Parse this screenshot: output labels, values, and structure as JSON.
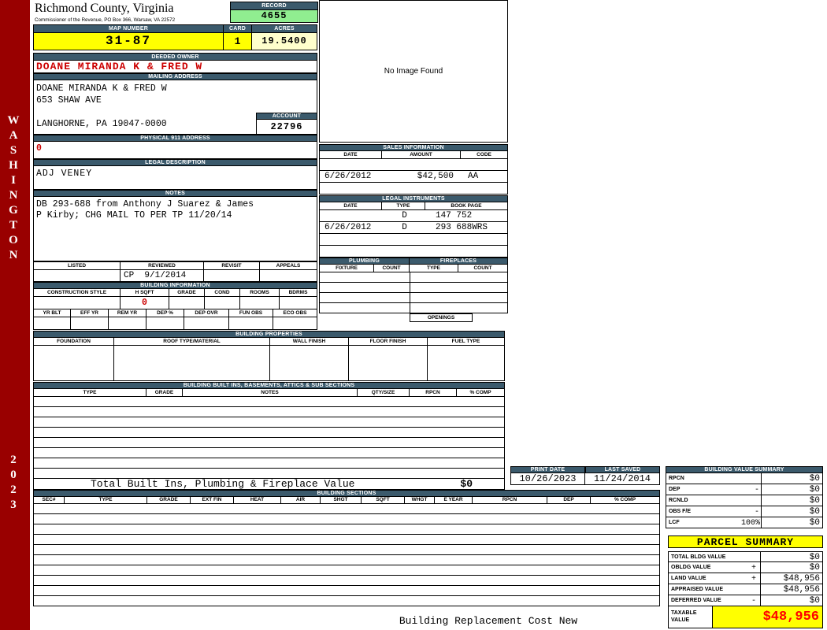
{
  "sidebar": {
    "vertical_text": "WASHINGTON",
    "year": "2023"
  },
  "county": {
    "title": "Richmond County, Virginia",
    "subtitle": "Commissioner of the Revenue, PO Box 366, Warsaw, VA 22572"
  },
  "record": {
    "label": "RECORD",
    "value": "4655"
  },
  "map": {
    "map_number_label": "MAP NUMBER",
    "map_number": "31-87",
    "card_label": "CARD",
    "card": "1",
    "acres_label": "ACRES",
    "acres": "19.5400"
  },
  "owner": {
    "deeded_owner_label": "DEEDED OWNER",
    "deeded_owner": "DOANE MIRANDA K & FRED W",
    "mailing_address_label": "MAILING ADDRESS",
    "mailing_line1": "DOANE MIRANDA K & FRED W",
    "mailing_line2": "653 SHAW AVE",
    "mailing_line3": "",
    "mailing_line4": "LANGHORNE, PA 19047-0000",
    "account_label": "ACCOUNT",
    "account": "22796",
    "physical_address_label": "PHYSICAL 911 ADDRESS",
    "physical_address": "0",
    "legal_description_label": "LEGAL DESCRIPTION",
    "legal_description": "ADJ VENEY",
    "notes_label": "NOTES",
    "notes_line1": "DB 293-688 from Anthony J Suarez & James",
    "notes_line2": "P Kirby; CHG MAIL TO PER TP 11/20/14"
  },
  "review": {
    "listed_label": "LISTED",
    "reviewed_label": "REVIEWED",
    "revisit_label": "REVISIT",
    "appeals_label": "APPEALS",
    "reviewed_value": "CP  9/1/2014"
  },
  "building_information": {
    "label": "BUILDING INFORMATION",
    "row1_headers": [
      "CONSTRUCTION STYLE",
      "H SQFT",
      "GRADE",
      "COND",
      "ROOMS",
      "BDRMS"
    ],
    "h_sqft_value": "0",
    "row2_headers": [
      "YR BLT",
      "EFF YR",
      "REM YR",
      "DEP %",
      "DEP OVR",
      "FUN OBS",
      "ECO OBS"
    ]
  },
  "building_properties": {
    "label": "BUILDING PROPERTIES",
    "headers": [
      "FOUNDATION",
      "ROOF TYPE/MATERIAL",
      "WALL FINISH",
      "FLOOR FINISH",
      "FUEL TYPE"
    ]
  },
  "built_ins": {
    "label": "BUILDING BUILT INS, BASEMENTS, ATTICS & SUB SECTIONS",
    "headers": [
      "TYPE",
      "GRADE",
      "NOTES",
      "QTY/SIZE",
      "RPCN",
      "% COMP"
    ],
    "total_label": "Total Built Ins, Plumbing & Fireplace Value",
    "total_value": "$0"
  },
  "building_sections": {
    "label": "BUILDING SECTIONS",
    "headers": [
      "SEC#",
      "TYPE",
      "GRADE",
      "EXT FIN",
      "HEAT",
      "AIR",
      "SHGT",
      "SQFT",
      "WHGT",
      "E YEAR",
      "RPCN",
      "DEP",
      "% COMP"
    ]
  },
  "image_panel": {
    "placeholder": "No Image Found"
  },
  "sales": {
    "label": "SALES INFORMATION",
    "headers": [
      "DATE",
      "AMOUNT",
      "CODE"
    ],
    "rows": [
      {
        "date": "",
        "amount": "",
        "code": ""
      },
      {
        "date": "6/26/2012",
        "amount": "$42,500",
        "code": "AA"
      },
      {
        "date": "",
        "amount": "",
        "code": ""
      }
    ]
  },
  "legal_instruments": {
    "label": "LEGAL INSTRUMENTS",
    "headers": [
      "DATE",
      "TYPE",
      "BOOK PAGE"
    ],
    "rows": [
      {
        "date": "",
        "type": "D",
        "book_page": "147 752"
      },
      {
        "date": "6/26/2012",
        "type": "D",
        "book_page": "293 688WRS"
      },
      {
        "date": "",
        "type": "",
        "book_page": ""
      },
      {
        "date": "",
        "type": "",
        "book_page": ""
      }
    ]
  },
  "plumbing": {
    "label": "PLUMBING",
    "headers": [
      "FIXTURE",
      "COUNT"
    ]
  },
  "fireplaces": {
    "label": "FIREPLACES",
    "headers": [
      "TYPE",
      "COUNT"
    ],
    "openings_label": "OPENINGS"
  },
  "dates": {
    "print_date_label": "PRINT DATE",
    "print_date": "10/26/2023",
    "last_saved_label": "LAST SAVED",
    "last_saved": "11/24/2014"
  },
  "building_value_summary": {
    "label": "BUILDING VALUE SUMMARY",
    "rows": [
      {
        "label": "RPCN",
        "op": "",
        "value": "$0"
      },
      {
        "label": "DEP",
        "op": "-",
        "value": "$0"
      },
      {
        "label": "RCNLD",
        "op": "",
        "value": "$0"
      },
      {
        "label": "OBS F/E",
        "op": "-",
        "value": "$0"
      },
      {
        "label": "LCF",
        "op": "100%",
        "value": "$0"
      }
    ]
  },
  "parcel_summary": {
    "label": "PARCEL SUMMARY",
    "rows": [
      {
        "label": "TOTAL BLDG VALUE",
        "op": "",
        "value": "$0"
      },
      {
        "label": "OBLDG VALUE",
        "op": "+",
        "value": "$0"
      },
      {
        "label": "LAND VALUE",
        "op": "+",
        "value": "$48,956"
      },
      {
        "label": "APPRAISED VALUE",
        "op": "",
        "value": "$48,956"
      },
      {
        "label": "DEFERRED VALUE",
        "op": "-",
        "value": "$0"
      }
    ],
    "taxable_label": "TAXABLE VALUE",
    "taxable_value": "$48,956"
  },
  "footer": {
    "text": "Building Replacement Cost New"
  },
  "colors": {
    "accent_bar": "#3b5a6c",
    "sidebar_red": "#990000",
    "highlight_yellow": "#ffff00",
    "record_green": "#90ee90",
    "taxable_red": "#ff0000"
  }
}
